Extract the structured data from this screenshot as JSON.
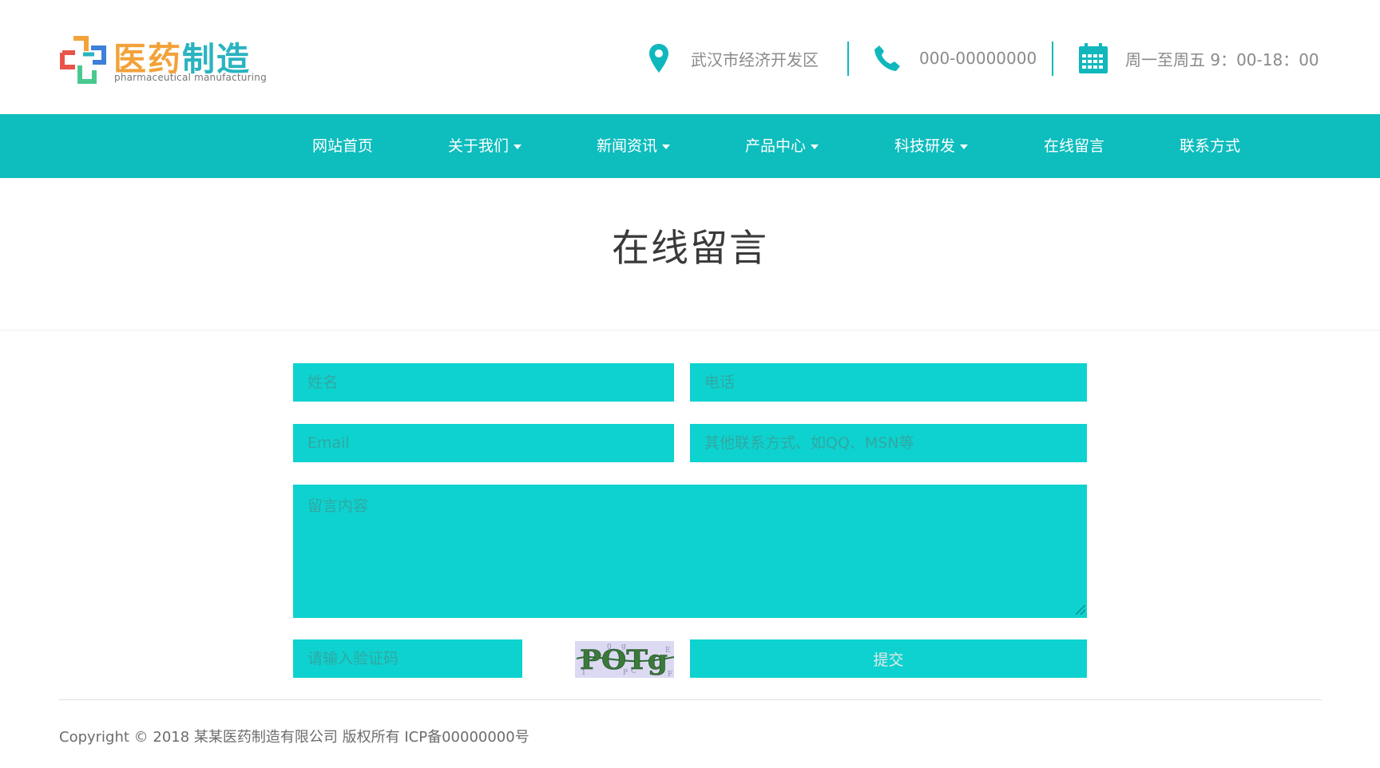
{
  "brand": {
    "title_part1": "医药",
    "title_part2": "制造",
    "subtitle": "pharmaceutical manufacturing",
    "colors": {
      "orange": "#f2a23a",
      "teal": "#2ab3c0",
      "red": "#e8544a",
      "blue": "#3d7fd9",
      "green": "#49c98f"
    }
  },
  "contact": {
    "address_icon": "location-pin-icon",
    "address": "武汉市经济开发区",
    "phone_icon": "phone-icon",
    "phone": "000-00000000",
    "hours_icon": "calendar-icon",
    "hours": "周一至周五 9：00-18：00"
  },
  "nav": {
    "items": [
      {
        "label": "网站首页",
        "dropdown": false
      },
      {
        "label": "关于我们",
        "dropdown": true
      },
      {
        "label": "新闻资讯",
        "dropdown": true
      },
      {
        "label": "产品中心",
        "dropdown": true
      },
      {
        "label": "科技研发",
        "dropdown": true
      },
      {
        "label": "在线留言",
        "dropdown": false
      },
      {
        "label": "联系方式",
        "dropdown": false
      }
    ]
  },
  "page": {
    "title": "在线留言"
  },
  "form": {
    "name_placeholder": "姓名",
    "phone_placeholder": "电话",
    "email_placeholder": "Email",
    "other_placeholder": "其他联系方式、如QQ、MSN等",
    "message_placeholder": "留言内容",
    "captcha_placeholder": "请输入验证码",
    "captcha_text": "POTg",
    "submit_label": "提交"
  },
  "footer": {
    "copyright": "Copyright © 2018 某某医药制造有限公司 版权所有 ICP备00000000号"
  },
  "colors": {
    "accent": "#0ebdbd",
    "field": "#0ed2cf"
  }
}
